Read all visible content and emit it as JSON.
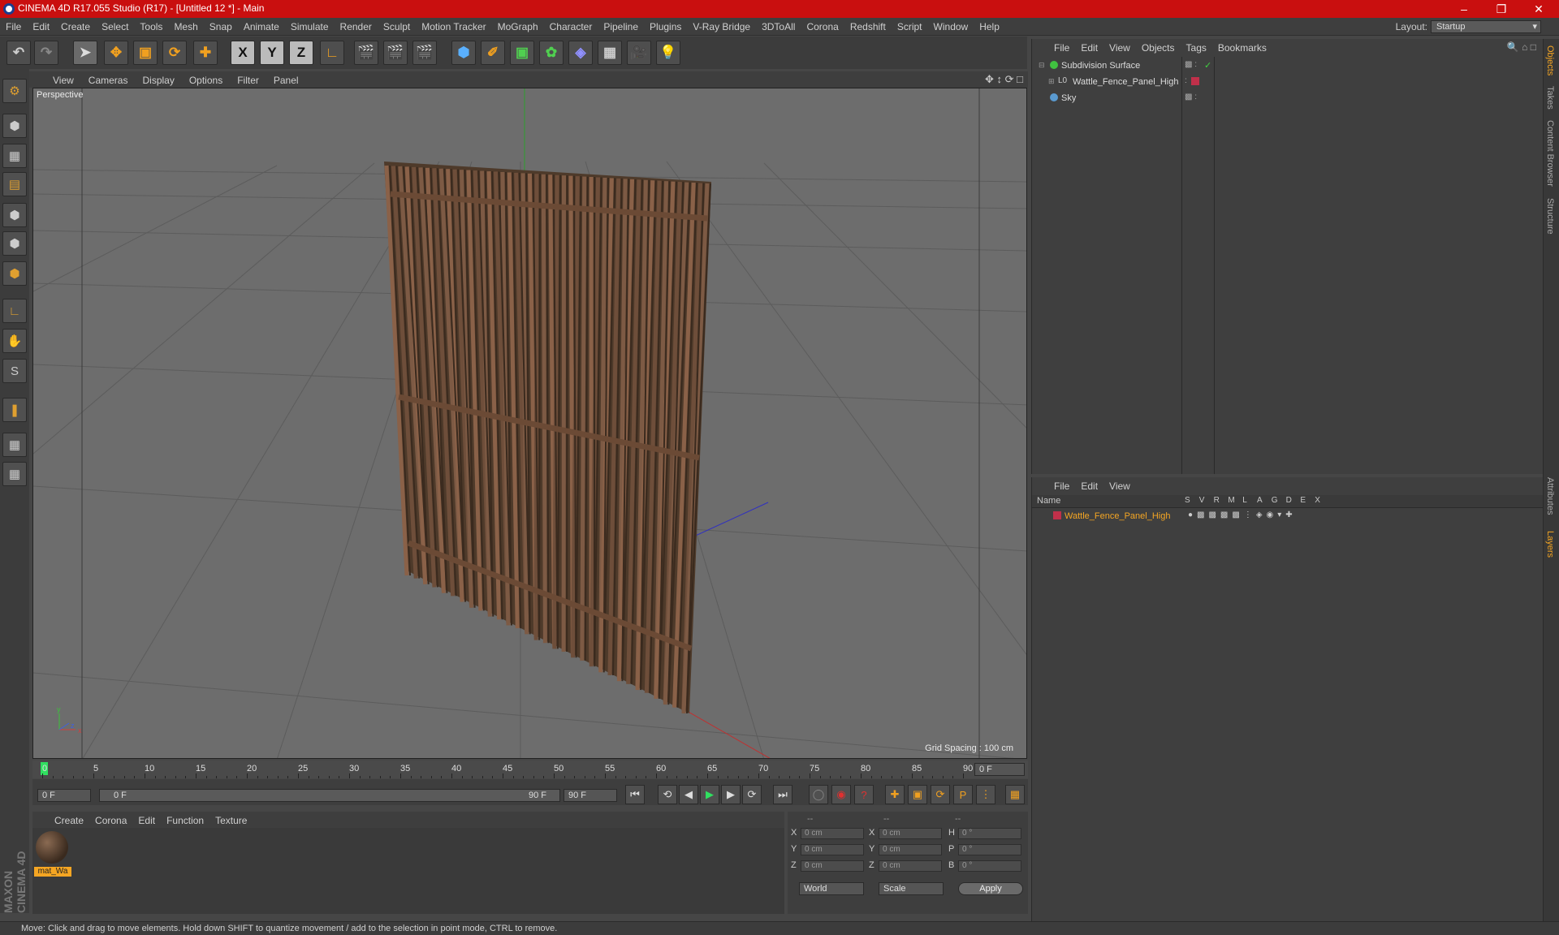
{
  "app": {
    "title": "CINEMA 4D R17.055 Studio (R17) - [Untitled 12 *] - Main",
    "window_buttons": [
      "minimize",
      "restore",
      "close"
    ]
  },
  "menubar": {
    "items": [
      "File",
      "Edit",
      "Create",
      "Select",
      "Tools",
      "Mesh",
      "Snap",
      "Animate",
      "Simulate",
      "Render",
      "Sculpt",
      "Motion Tracker",
      "MoGraph",
      "Character",
      "Pipeline",
      "Plugins",
      "V-Ray Bridge",
      "3DToAll",
      "Corona",
      "Redshift",
      "Script",
      "Window",
      "Help"
    ],
    "layout_label": "Layout:",
    "layout_value": "Startup"
  },
  "toolbar": {
    "axes": [
      "X",
      "Y",
      "Z"
    ]
  },
  "viewport": {
    "menu": [
      "View",
      "Cameras",
      "Display",
      "Options",
      "Filter",
      "Panel"
    ],
    "label": "Perspective",
    "grid_spacing": "Grid Spacing : 100 cm"
  },
  "timeline": {
    "ticks": [
      "0",
      "5",
      "10",
      "15",
      "20",
      "25",
      "30",
      "35",
      "40",
      "45",
      "50",
      "55",
      "60",
      "65",
      "70",
      "75",
      "80",
      "85",
      "90"
    ],
    "current_frame": "0 F",
    "start": "0 F",
    "range_start": "0 F",
    "range_end": "90 F",
    "end": "90 F"
  },
  "material": {
    "menu": [
      "Create",
      "Corona",
      "Edit",
      "Function",
      "Texture"
    ],
    "item": "mat_Wa"
  },
  "coords": {
    "headers": [
      "--",
      "--",
      "--"
    ],
    "rows": [
      {
        "a": "X",
        "av": "0 cm",
        "b": "X",
        "bv": "0 cm",
        "c": "H",
        "cv": "0 °"
      },
      {
        "a": "Y",
        "av": "0 cm",
        "b": "Y",
        "bv": "0 cm",
        "c": "P",
        "cv": "0 °"
      },
      {
        "a": "Z",
        "av": "0 cm",
        "b": "Z",
        "bv": "0 cm",
        "c": "B",
        "cv": "0 °"
      }
    ],
    "mode": "World",
    "scale": "Scale",
    "apply": "Apply"
  },
  "objects": {
    "menu": [
      "File",
      "Edit",
      "View",
      "Objects",
      "Tags",
      "Bookmarks"
    ],
    "items": [
      "Subdivision Surface",
      "Wattle_Fence_Panel_High",
      "Sky"
    ]
  },
  "layers": {
    "menu": [
      "File",
      "Edit",
      "View"
    ],
    "name_header": "Name",
    "cols": [
      "S",
      "V",
      "R",
      "M",
      "L",
      "A",
      "G",
      "D",
      "E",
      "X"
    ],
    "item": "Wattle_Fence_Panel_High"
  },
  "sidetabs": [
    "Objects",
    "Takes",
    "Content Browser",
    "Structure",
    "Attributes",
    "Layers"
  ],
  "status": "Move: Click and drag to move elements. Hold down SHIFT to quantize movement / add to the selection in point mode, CTRL to remove.",
  "colors": {
    "title_bg": "#c90f0f",
    "accent": "#f5a623",
    "layer_red": "#c0304a"
  }
}
